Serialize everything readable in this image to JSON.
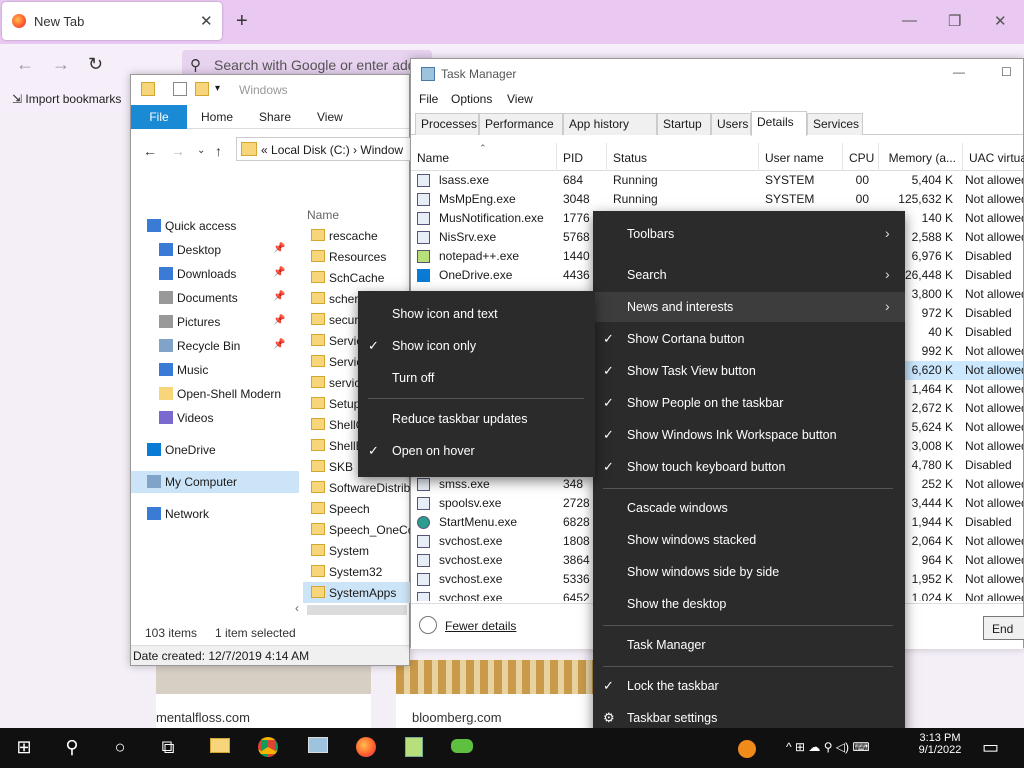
{
  "browser": {
    "tab_title": "New Tab",
    "close_glyph": "✕",
    "new_tab_glyph": "+",
    "window_min": "—",
    "window_restore": "❐",
    "window_close": "✕",
    "search_placeholder": "Search with Google or enter add",
    "import_bookmarks": "Import bookmarks",
    "tiles": [
      "mentalfloss.com",
      "bloomberg.com"
    ]
  },
  "explorer": {
    "title": "Windows",
    "ribbon": {
      "file": "File",
      "home": "Home",
      "share": "Share",
      "view": "View"
    },
    "address": "Local Disk (C:)  ›  Window",
    "address_prefix": "«",
    "nav": [
      {
        "label": "Quick access",
        "icon": "star-icon"
      },
      {
        "label": "Desktop",
        "icon": "desktop-icon",
        "pinned": true
      },
      {
        "label": "Downloads",
        "icon": "download-icon",
        "pinned": true
      },
      {
        "label": "Documents",
        "icon": "document-icon",
        "pinned": true
      },
      {
        "label": "Pictures",
        "icon": "pictures-icon",
        "pinned": true
      },
      {
        "label": "Recycle Bin",
        "icon": "recycle-bin-icon",
        "pinned": true
      },
      {
        "label": "Music",
        "icon": "music-icon"
      },
      {
        "label": "Open-Shell Modern",
        "icon": "folder-icon"
      },
      {
        "label": "Videos",
        "icon": "video-icon"
      },
      {
        "label": "OneDrive",
        "icon": "cloud-icon"
      },
      {
        "label": "My Computer",
        "icon": "computer-icon"
      },
      {
        "label": "Network",
        "icon": "network-icon"
      }
    ],
    "files_header": "Name",
    "files": [
      "rescache",
      "Resources",
      "SchCache",
      "scher",
      "secur",
      "Servic",
      "Servic",
      "servic",
      "Setup",
      "ShellC",
      "ShellE",
      "SKB",
      "SoftwareDistribu",
      "Speech",
      "Speech_OneCor",
      "System",
      "System32",
      "SystemApps"
    ],
    "item_count": "103 items",
    "selected": "1 item selected",
    "date_created": "Date created: 12/7/2019 4:14 AM"
  },
  "taskmgr": {
    "title": "Task Manager",
    "menu": [
      "File",
      "Options",
      "View"
    ],
    "tabs": [
      "Processes",
      "Performance",
      "App history",
      "Startup",
      "Users",
      "Details",
      "Services"
    ],
    "active_tab": "Details",
    "columns": [
      "Name",
      "PID",
      "Status",
      "User name",
      "CPU",
      "Memory (a...",
      "UAC virtual"
    ],
    "rows": [
      {
        "name": "lsass.exe",
        "pid": "684",
        "status": "Running",
        "user": "SYSTEM",
        "cpu": "00",
        "mem": "5,404 K",
        "uac": "Not allowed"
      },
      {
        "name": "MsMpEng.exe",
        "pid": "3048",
        "status": "Running",
        "user": "SYSTEM",
        "cpu": "00",
        "mem": "125,632 K",
        "uac": "Not allowed"
      },
      {
        "name": "MusNotification.exe",
        "pid": "1776",
        "mem": "140 K",
        "uac": "Not allowed"
      },
      {
        "name": "NisSrv.exe",
        "pid": "5768",
        "mem": "2,588 K",
        "uac": "Not allowed"
      },
      {
        "name": "notepad++.exe",
        "pid": "1440",
        "mem": "6,976 K",
        "uac": "Disabled"
      },
      {
        "name": "OneDrive.exe",
        "pid": "4436",
        "mem": "26,448 K",
        "uac": "Disabled"
      },
      {
        "name": "",
        "pid": "",
        "mem": "3,800 K",
        "uac": "Not allowed"
      },
      {
        "name": "",
        "pid": "",
        "mem": "972 K",
        "uac": "Disabled"
      },
      {
        "name": "",
        "pid": "",
        "mem": "40 K",
        "uac": "Disabled"
      },
      {
        "name": "",
        "pid": "",
        "mem": "992 K",
        "uac": "Not allowed"
      },
      {
        "name": "",
        "pid": "",
        "mem": "6,620 K",
        "uac": "Not allowed"
      },
      {
        "name": "",
        "pid": "",
        "mem": "1,464 K",
        "uac": "Not allowed"
      },
      {
        "name": "",
        "pid": "",
        "mem": "2,672 K",
        "uac": "Not allowed"
      },
      {
        "name": "",
        "pid": "",
        "mem": "5,624 K",
        "uac": "Not allowed"
      },
      {
        "name": "",
        "pid": "",
        "mem": "3,008 K",
        "uac": "Not allowed"
      },
      {
        "name": "",
        "pid": "",
        "mem": "4,780 K",
        "uac": "Disabled"
      },
      {
        "name": "smss.exe",
        "pid": "348",
        "mem": "252 K",
        "uac": "Not allowed"
      },
      {
        "name": "spoolsv.exe",
        "pid": "2728",
        "mem": "3,444 K",
        "uac": "Not allowed"
      },
      {
        "name": "StartMenu.exe",
        "pid": "6828",
        "mem": "1,944 K",
        "uac": "Disabled"
      },
      {
        "name": "svchost.exe",
        "pid": "1808",
        "mem": "2,064 K",
        "uac": "Not allowed"
      },
      {
        "name": "svchost.exe",
        "pid": "3864",
        "mem": "964 K",
        "uac": "Not allowed"
      },
      {
        "name": "svchost.exe",
        "pid": "5336",
        "mem": "1,952 K",
        "uac": "Not allowed"
      },
      {
        "name": "svchost.exe",
        "pid": "6452",
        "mem": "1,024 K",
        "uac": "Not allowed"
      }
    ],
    "fewer_details": "Fewer details",
    "end_task": "End"
  },
  "taskbar_menu": [
    {
      "label": "Toolbars",
      "arrow": true
    },
    {
      "label": "Search",
      "arrow": true
    },
    {
      "label": "News and interests",
      "arrow": true,
      "hover": true
    },
    {
      "label": "Show Cortana button",
      "check": true
    },
    {
      "label": "Show Task View button",
      "check": true
    },
    {
      "label": "Show People on the taskbar",
      "check": true
    },
    {
      "label": "Show Windows Ink Workspace button",
      "check": true
    },
    {
      "label": "Show touch keyboard button",
      "check": true
    },
    {
      "label": "Cascade windows"
    },
    {
      "label": "Show windows stacked"
    },
    {
      "label": "Show windows side by side"
    },
    {
      "label": "Show the desktop"
    },
    {
      "label": "Task Manager"
    },
    {
      "label": "Lock the taskbar",
      "check": true
    },
    {
      "label": "Taskbar settings",
      "icon": "gear-icon"
    }
  ],
  "news_submenu": [
    {
      "label": "Show icon and text"
    },
    {
      "label": "Show icon only",
      "check": true
    },
    {
      "label": "Turn off"
    },
    {
      "label": "Reduce taskbar updates"
    },
    {
      "label": "Open on hover",
      "check": true
    }
  ],
  "check_glyph": "✓",
  "arrow_glyph": "›",
  "gear_glyph": "⚙",
  "taskbar": {
    "time": "3:13 PM",
    "date": "9/1/2022",
    "icons": [
      "windows-start-icon",
      "search-icon",
      "cortana-icon",
      "task-view-icon",
      "file-explorer-icon",
      "chrome-icon",
      "task-manager-icon",
      "firefox-icon",
      "notepadpp-icon",
      "frog-app-icon"
    ],
    "tray": "^  ⊞  ☁  ⚲  ◁)  ⌨",
    "notification_glyph": "▭"
  }
}
